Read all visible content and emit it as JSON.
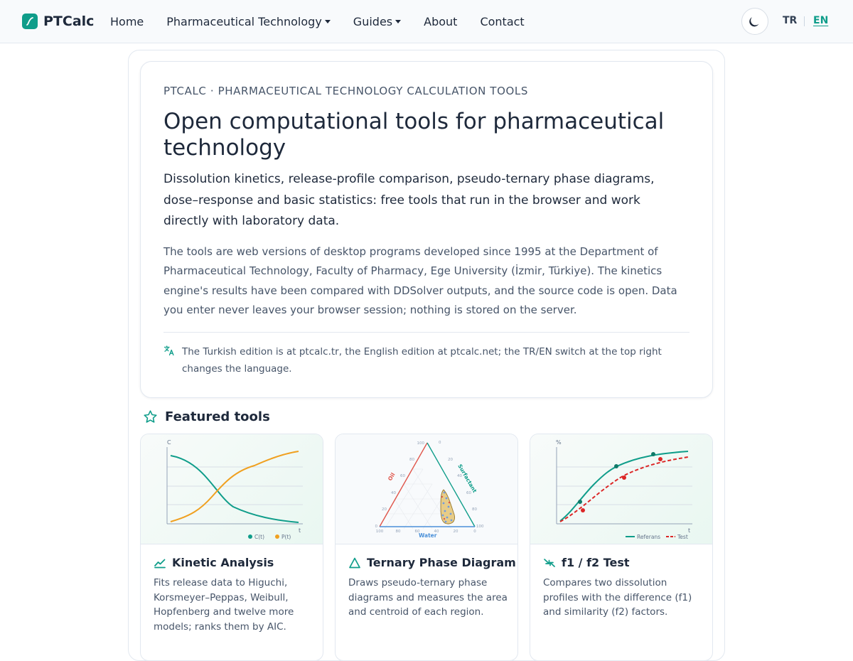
{
  "brand": {
    "name": "PTCalc"
  },
  "nav": {
    "home": "Home",
    "pharm_tech": "Pharmaceutical Technology",
    "guides": "Guides",
    "about": "About",
    "contact": "Contact"
  },
  "lang": {
    "tr": "TR",
    "en": "EN",
    "active": "EN"
  },
  "hero": {
    "eyebrow": "PTCALC · PHARMACEUTICAL TECHNOLOGY CALCULATION TOOLS",
    "title": "Open computational tools for pharmaceutical technology",
    "lead": "Dissolution kinetics, release-profile comparison, pseudo-ternary phase diagrams, dose–response and basic statistics: free tools that run in the browser and work directly with laboratory data.",
    "body": "The tools are web versions of desktop programs developed since 1995 at the Department of Pharmaceutical Technology, Faculty of Pharmacy, Ege University (İzmir, Türkiye). The kinetics engine's results have been compared with DDSolver outputs, and the source code is open. Data you enter never leaves your browser session; nothing is stored on the server.",
    "note": "The Turkish edition is at ptcalc.tr, the English edition at ptcalc.net; the TR/EN switch at the top right changes the language."
  },
  "featured": {
    "title": "Featured tools",
    "cards": [
      {
        "title": "Kinetic Analysis",
        "desc": "Fits release data to Higuchi, Korsmeyer–Peppas, Weibull, Hopfenberg and twelve more models; ranks them by AIC.",
        "chart": {
          "y_axis": "C",
          "x_axis": "t",
          "legend": [
            "C(t)",
            "P(t)"
          ]
        }
      },
      {
        "title": "Ternary Phase Diagram",
        "desc": "Draws pseudo-ternary phase diagrams and measures the area and centroid of each region.",
        "chart": {
          "edge_labels": [
            "Oil",
            "Surfactant",
            "Water"
          ],
          "left_ticks": [
            "100",
            "80",
            "60",
            "40",
            "20",
            "0"
          ],
          "right_ticks": [
            "0",
            "20",
            "40",
            "60",
            "80",
            "100"
          ],
          "bottom_ticks": [
            "100",
            "80",
            "60",
            "40",
            "20",
            "0"
          ]
        }
      },
      {
        "title": "f1 / f2 Test",
        "desc": "Compares two dissolution profiles with the difference (f1) and similarity (f2) factors.",
        "chart": {
          "y_axis": "%",
          "x_axis": "t",
          "legend": [
            "Referans",
            "Test"
          ]
        }
      }
    ]
  },
  "colors": {
    "accent": "#0f9d8a",
    "orange": "#f0a020",
    "red": "#dc2626",
    "text": "#1e293b",
    "muted": "#475569"
  }
}
